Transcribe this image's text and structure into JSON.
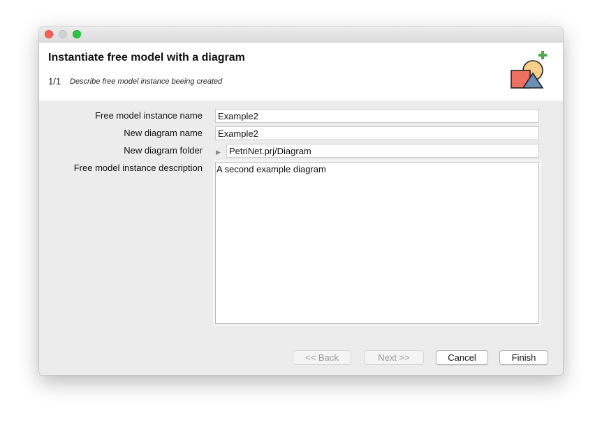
{
  "dialog": {
    "title": "Instantiate free model with a diagram",
    "step_counter": "1/1",
    "step_description": "Describe free model instance beeing created",
    "header_icon": "add-diagram-shapes-icon"
  },
  "form": {
    "instance_name_label": "Free model instance name",
    "instance_name_value": "Example2",
    "diagram_name_label": "New diagram name",
    "diagram_name_value": "Example2",
    "diagram_folder_label": "New diagram folder",
    "diagram_folder_value": "PetriNet.prj/Diagram",
    "description_label": "Free model instance description",
    "description_value": "A second example diagram"
  },
  "buttons": {
    "back": "<< Back",
    "next": "Next >>",
    "cancel": "Cancel",
    "finish": "Finish"
  },
  "colors": {
    "close": "#fd5f57",
    "minimize": "#d2d2d2",
    "maximize": "#28c840"
  }
}
